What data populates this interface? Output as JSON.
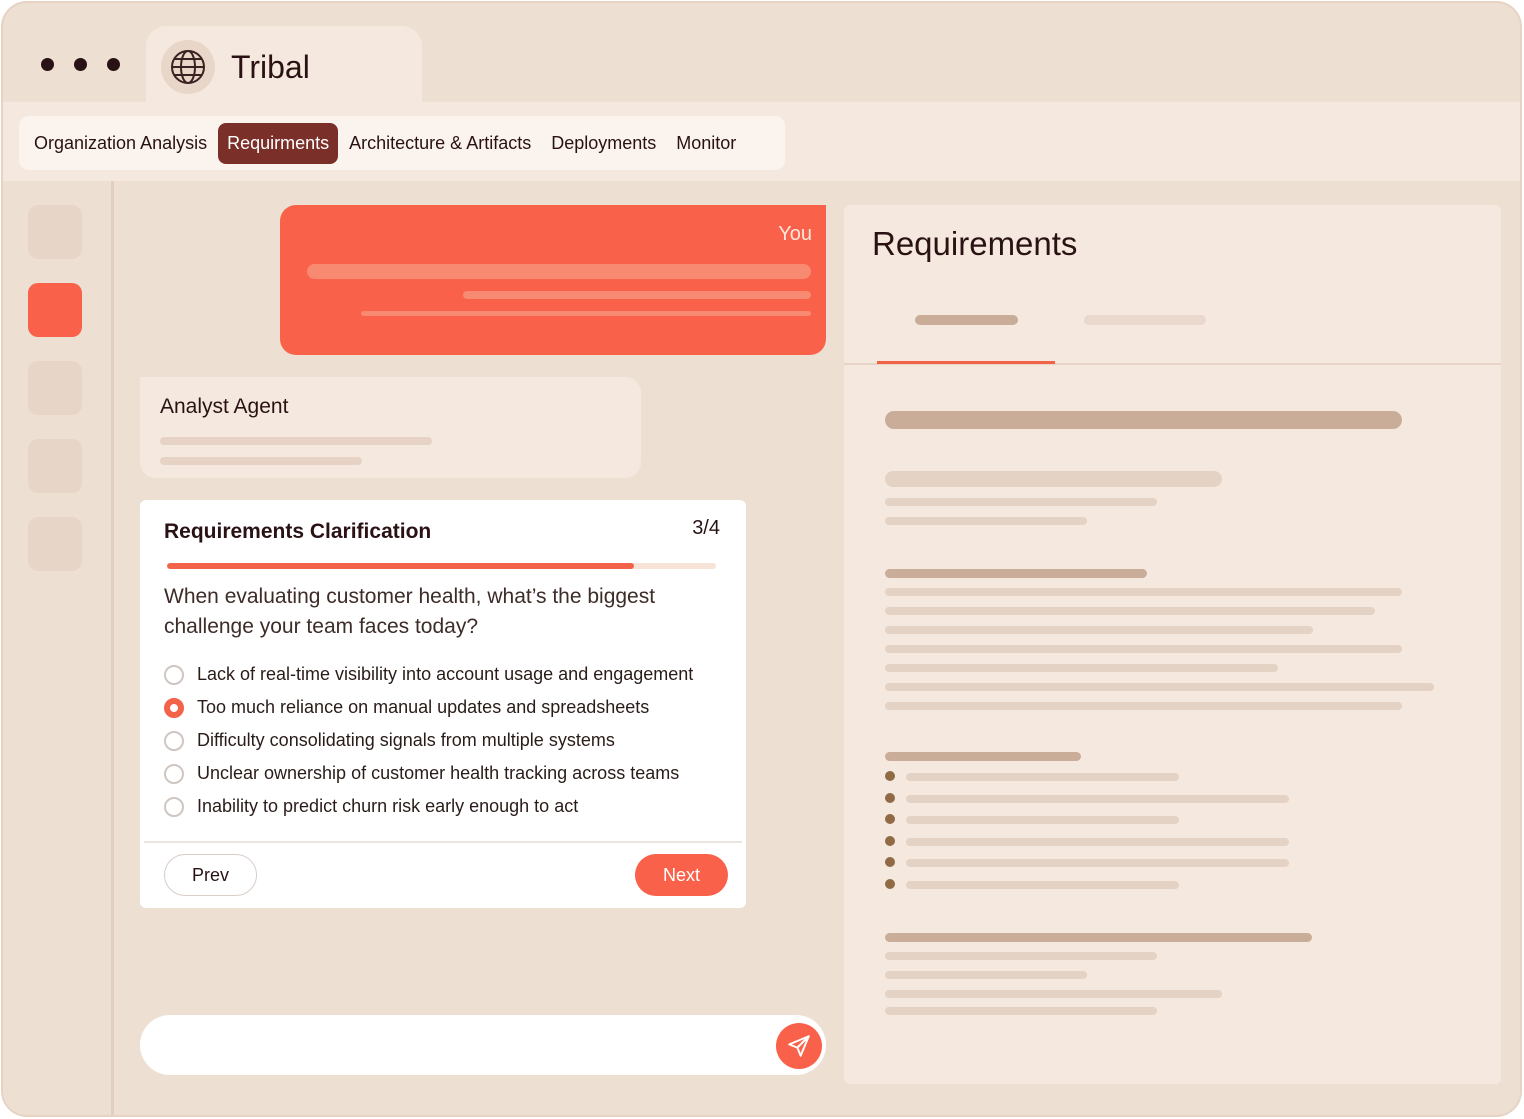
{
  "app": {
    "title": "Tribal",
    "logo_icon": "globe-icon"
  },
  "nav": {
    "items": [
      {
        "label": "Organization Analysis",
        "active": false
      },
      {
        "label": "Requirments",
        "active": true
      },
      {
        "label": "Architecture & Artifacts",
        "active": false
      },
      {
        "label": "Deployments",
        "active": false
      },
      {
        "label": "Monitor",
        "active": false
      }
    ]
  },
  "chat": {
    "user_label": "You",
    "agent_label": "Analyst Agent"
  },
  "question_card": {
    "title": "Requirements Clarification",
    "step": "3/4",
    "progress": 0.85,
    "question": "When evaluating customer health, what’s the biggest challenge your team faces today?",
    "options": [
      {
        "label": "Lack of real-time visibility into account usage and engagement",
        "selected": false
      },
      {
        "label": "Too much reliance on manual updates and spreadsheets",
        "selected": true
      },
      {
        "label": "Difficulty consolidating signals from multiple systems",
        "selected": false
      },
      {
        "label": "Unclear ownership of customer health tracking across teams",
        "selected": false
      },
      {
        "label": "Inability to predict churn risk early enough to act",
        "selected": false
      }
    ],
    "prev_label": "Prev",
    "next_label": "Next"
  },
  "panel": {
    "title": "Requirements"
  },
  "colors": {
    "accent": "#f9614a",
    "nav_active": "#7a2f29",
    "background": "#eddfd2",
    "panel": "#f5e9df"
  }
}
